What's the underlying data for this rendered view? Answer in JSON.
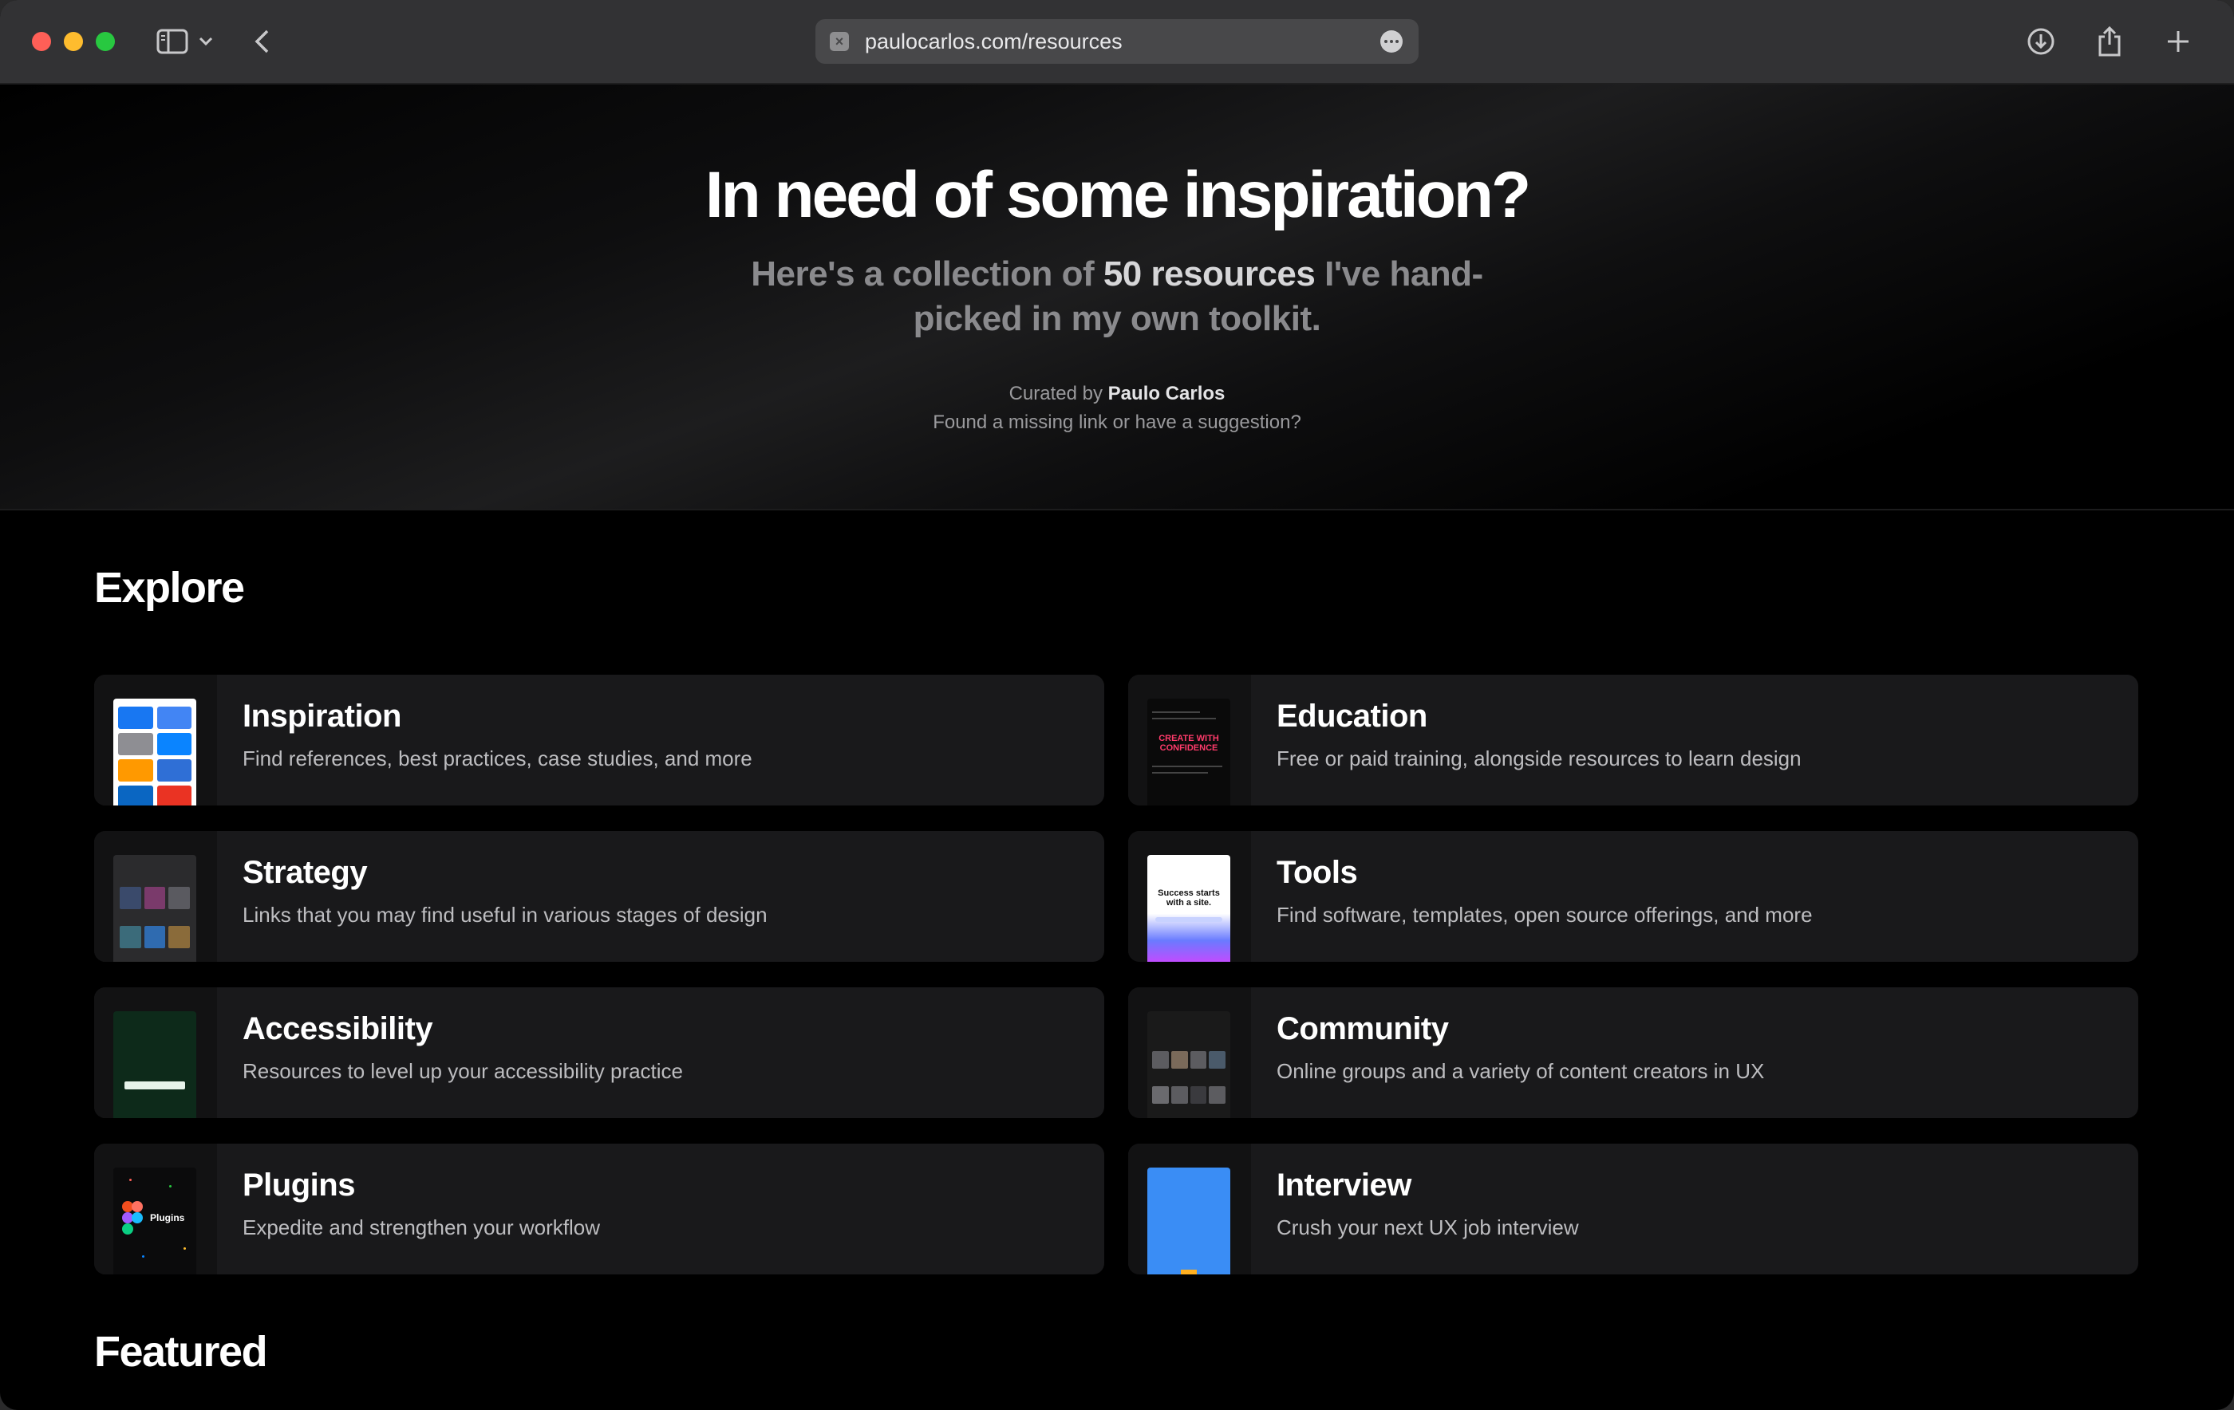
{
  "browser": {
    "url": "paulocarlos.com/resources"
  },
  "hero": {
    "title": "In need of some inspiration?",
    "subtitle_pre": "Here's a collection of ",
    "subtitle_strong": "50 resources",
    "subtitle_post": " I've hand-picked in my own toolkit.",
    "curated_pre": "Curated by ",
    "curated_name": "Paulo Carlos",
    "suggestion": "Found a missing link or have a suggestion?"
  },
  "explore": {
    "heading": "Explore",
    "cards": [
      {
        "title": "Inspiration",
        "description": "Find references, best practices, case studies, and more"
      },
      {
        "title": "Education",
        "description": "Free or paid training, alongside resources to learn design"
      },
      {
        "title": "Strategy",
        "description": "Links that you may find useful in various stages of design"
      },
      {
        "title": "Tools",
        "description": "Find software, templates, open source offerings, and more"
      },
      {
        "title": "Accessibility",
        "description": "Resources to level up your accessibility practice"
      },
      {
        "title": "Community",
        "description": "Online groups and a variety of content creators in UX"
      },
      {
        "title": "Plugins",
        "description": "Expedite and strengthen your workflow"
      },
      {
        "title": "Interview",
        "description": "Crush your next UX job interview"
      }
    ]
  },
  "featured": {
    "heading": "Featured"
  },
  "thumbnail_text": {
    "education": "CREATE WITH CONFIDENCE",
    "tools": "Success starts with a site.",
    "plugins": "Plugins"
  }
}
